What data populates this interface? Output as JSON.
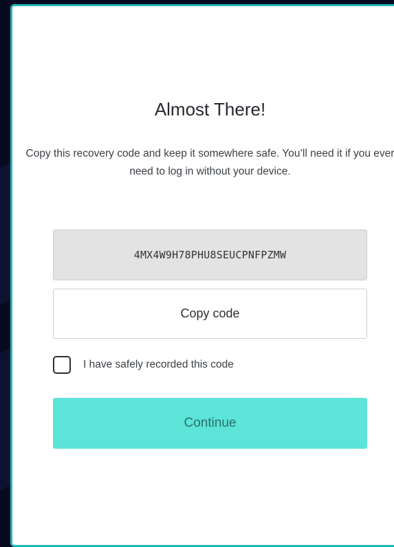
{
  "modal": {
    "title": "Almost There!",
    "description": "Copy this recovery code and keep it somewhere safe. You’ll need it if you ever need to log in without your device.",
    "recovery_code": "4MX4W9H78PHU8SEUCPNFPZMW",
    "copy_button_label": "Copy code",
    "checkbox_label": "I have safely recorded this code",
    "checkbox_checked": false,
    "continue_button_label": "Continue"
  },
  "colors": {
    "background": "#060a1e",
    "card_border": "#1fb7b5",
    "continue_button": "#5ce4d8",
    "code_box": "#e3e3e3"
  }
}
